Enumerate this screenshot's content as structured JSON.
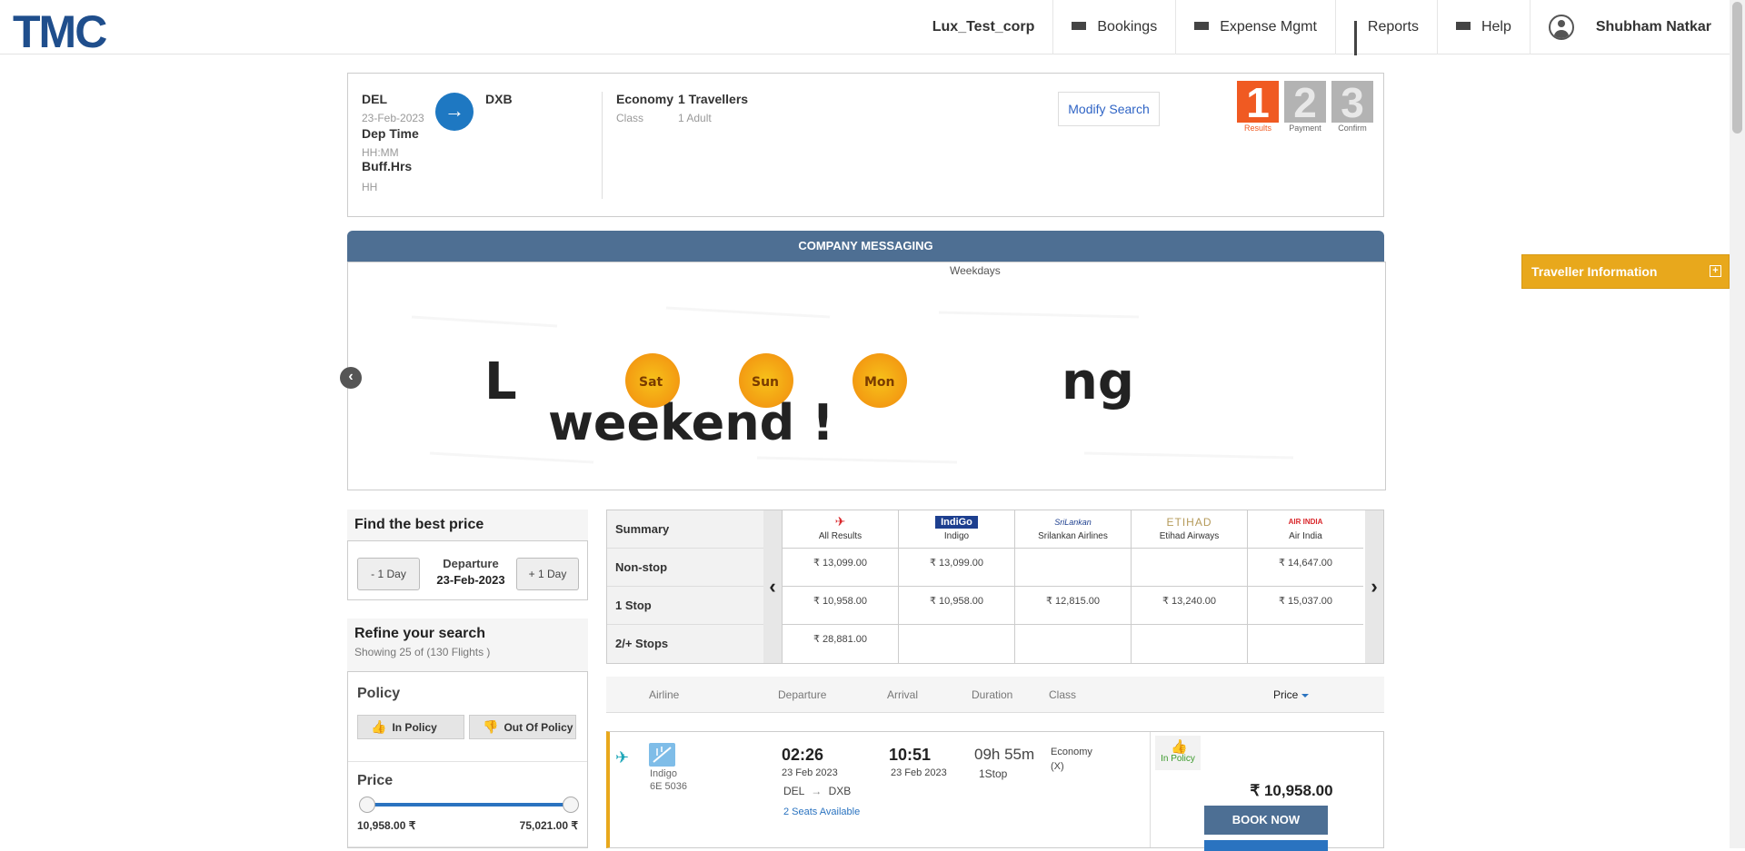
{
  "brand": {
    "logo": "TMC"
  },
  "nav": {
    "company": "Lux_Test_corp",
    "bookings": "Bookings",
    "expense": "Expense Mgmt",
    "reports": "Reports",
    "help": "Help",
    "user": "Shubham Natkar"
  },
  "search": {
    "from_code": "DEL",
    "date": "23-Feb-2023",
    "dep_time_label": "Dep Time",
    "dep_time_value": "HH:MM",
    "buff_label": "Buff.Hrs",
    "buff_value": "HH",
    "to_code": "DXB",
    "class_value": "Economy",
    "class_label": "Class",
    "travellers_value": "1 Travellers",
    "travellers_label": "1 Adult",
    "modify_label": "Modify Search"
  },
  "steps": [
    {
      "num": "1",
      "label": "Results"
    },
    {
      "num": "2",
      "label": "Payment"
    },
    {
      "num": "3",
      "label": "Confirm"
    }
  ],
  "messaging": {
    "header": "COMPANY MESSAGING",
    "caption": "Weekdays",
    "banner_text_top": "L",
    "banner_text_end": "ng",
    "banner_text_bottom": "weekend !",
    "suns": [
      "Sat",
      "Sun",
      "Mon"
    ]
  },
  "traveller_info": "Traveller Information",
  "best_price": {
    "title": "Find the best price",
    "minus": "- 1 Day",
    "plus": "+ 1 Day",
    "departure_label": "Departure",
    "departure_date": "23-Feb-2023"
  },
  "refine": {
    "title": "Refine your search",
    "subtitle": "Showing 25 of (130 Flights )",
    "policy_title": "Policy",
    "in_policy": "In Policy",
    "out_policy": "Out Of Policy",
    "price_title": "Price",
    "price_min": "10,958.00 ₹",
    "price_max": "75,021.00 ₹"
  },
  "matrix": {
    "rows": [
      "Summary",
      "Non-stop",
      "1 Stop",
      "2/+ Stops"
    ],
    "columns": [
      {
        "name": "All Results",
        "logo": "air-plane",
        "cells": [
          "₹ 13,099.00",
          "₹ 10,958.00",
          "₹ 28,881.00"
        ]
      },
      {
        "name": "Indigo",
        "logo": "IndiGo",
        "cells": [
          "₹ 13,099.00",
          "₹ 10,958.00",
          ""
        ]
      },
      {
        "name": "Srilankan Airlines",
        "logo": "SriLankan",
        "cells": [
          "",
          "₹ 12,815.00",
          ""
        ]
      },
      {
        "name": "Etihad Airways",
        "logo": "ETIHAD",
        "cells": [
          "",
          "₹ 13,240.00",
          ""
        ]
      },
      {
        "name": "Air India",
        "logo": "AIR INDIA",
        "cells": [
          "₹ 14,647.00",
          "₹ 15,037.00",
          ""
        ]
      }
    ]
  },
  "results_header": {
    "airline": "Airline",
    "departure": "Departure",
    "arrival": "Arrival",
    "duration": "Duration",
    "class": "Class",
    "price": "Price"
  },
  "flight": {
    "airline": "Indigo",
    "code": "6E  5036",
    "dep_time": "02:26",
    "dep_date": "23 Feb 2023",
    "from": "DEL",
    "to": "DXB",
    "seats": "2 Seats Available",
    "arr_time": "10:51",
    "arr_date": "23 Feb 2023",
    "duration": "09h 55m",
    "stops": "1Stop",
    "class": "Economy",
    "class_code": "(X)",
    "policy": "In Policy",
    "price": "₹ 10,958.00",
    "book": "BOOK NOW"
  },
  "colors": {
    "brand": "#1f4e8c",
    "accent": "#1e78c2",
    "step_active": "#f05a22",
    "traveller_bar": "#e8a81c",
    "book_button": "#4d6f94"
  }
}
